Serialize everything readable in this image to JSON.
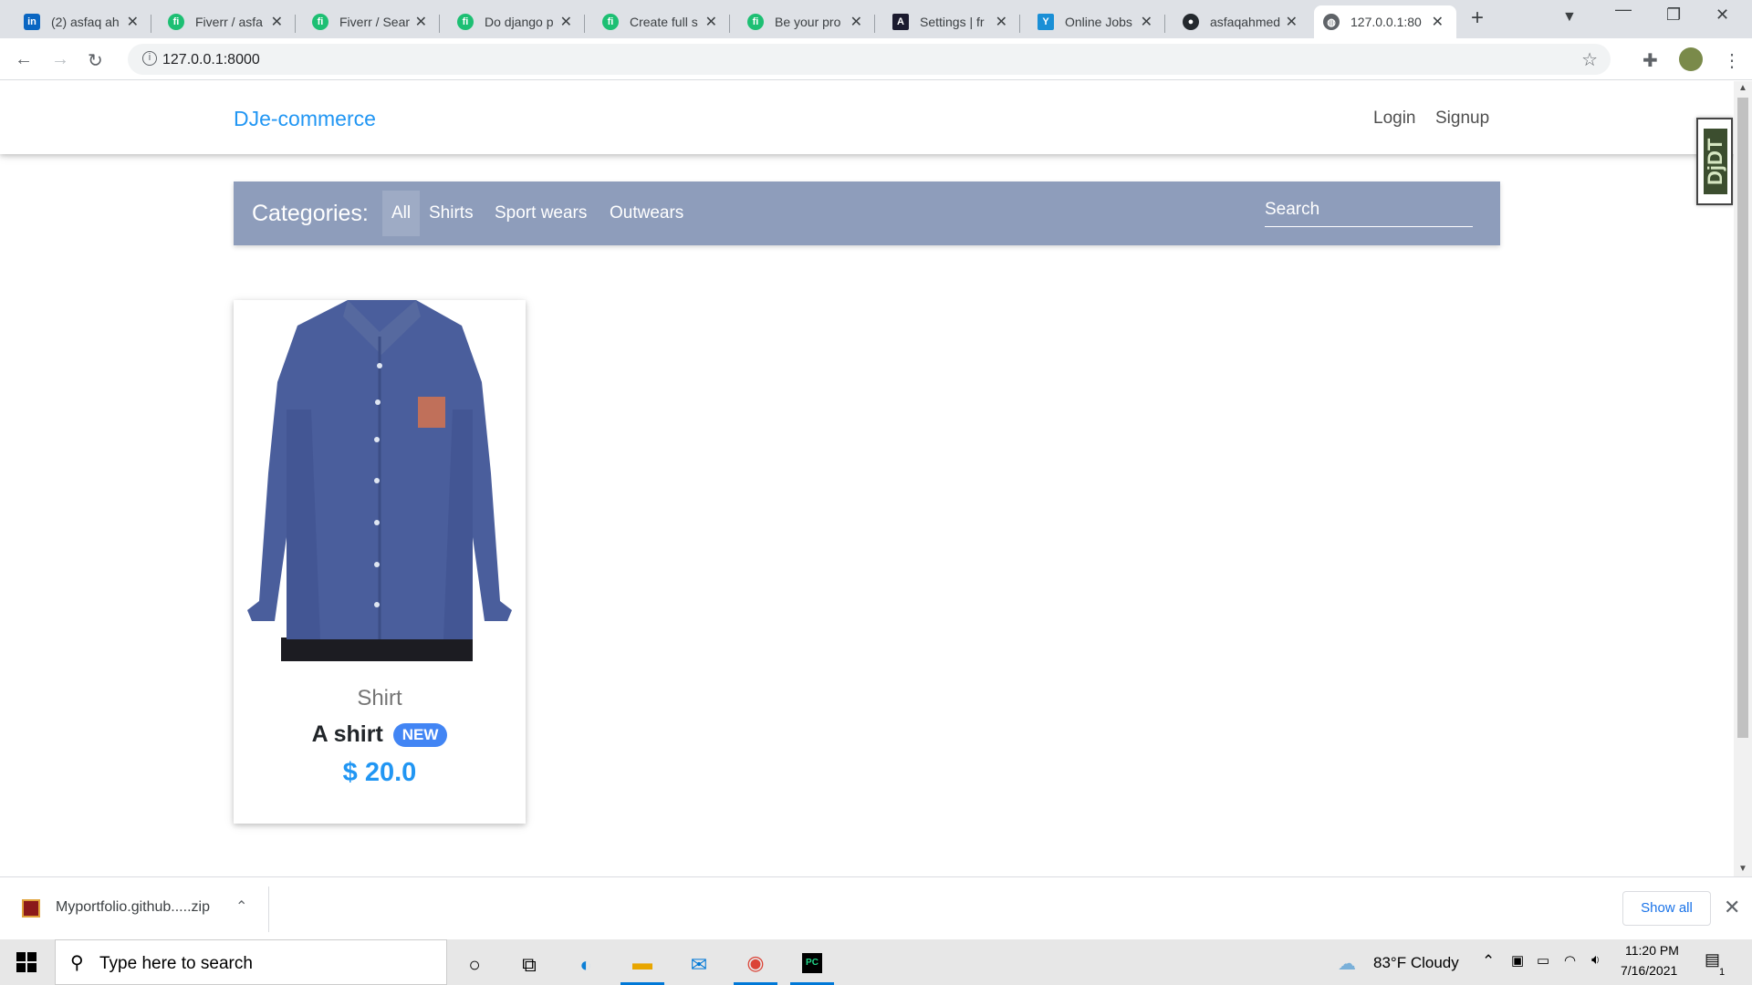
{
  "browser": {
    "tabs": [
      {
        "title": "(2) asfaq ah",
        "icon": "linkedin-icon",
        "color": "#0a66c2",
        "glyph": "in"
      },
      {
        "title": "Fiverr / asfa",
        "icon": "fiverr-icon",
        "color": "#1dbf73",
        "glyph": "fi"
      },
      {
        "title": "Fiverr / Sear",
        "icon": "fiverr-icon",
        "color": "#1dbf73",
        "glyph": "fi"
      },
      {
        "title": "Do django p",
        "icon": "fiverr-icon",
        "color": "#1dbf73",
        "glyph": "fi"
      },
      {
        "title": "Create full s",
        "icon": "fiverr-icon",
        "color": "#1dbf73",
        "glyph": "fi"
      },
      {
        "title": "Be your pro",
        "icon": "fiverr-icon",
        "color": "#1dbf73",
        "glyph": "fi"
      },
      {
        "title": "Settings | fr",
        "icon": "settings-site-icon",
        "color": "#1b1b2f",
        "glyph": "A"
      },
      {
        "title": "Online Jobs",
        "icon": "upwork-y-icon",
        "color": "#1a8fd6",
        "glyph": "Y"
      },
      {
        "title": "asfaqahmed",
        "icon": "github-icon",
        "color": "#24292e",
        "glyph": "●"
      },
      {
        "title": "127.0.0.1:80",
        "icon": "globe-icon",
        "color": "#5f6368",
        "glyph": "◍"
      }
    ],
    "url": "127.0.0.1:8000"
  },
  "site": {
    "brand": "DJe-commerce",
    "nav": {
      "login": "Login",
      "signup": "Signup"
    },
    "categories_title": "Categories:",
    "categories": [
      "All",
      "Shirts",
      "Sport wears",
      "Outwears"
    ],
    "search_placeholder": "Search",
    "products": [
      {
        "category": "Shirt",
        "name": "A shirt",
        "badge": "NEW",
        "price": "$ 20.0"
      }
    ],
    "debug_toolbar": "DjDT"
  },
  "downloads": {
    "file": "Myportfolio.github.....zip",
    "show_all": "Show all"
  },
  "taskbar": {
    "search_placeholder": "Type here to search",
    "weather": "83°F  Cloudy",
    "time": "11:20 PM",
    "date": "7/16/2021",
    "notifications": "1"
  },
  "colors": {
    "brand": "#2196f3",
    "category_bar": "#8e9dbb",
    "badge": "#4285f4"
  }
}
